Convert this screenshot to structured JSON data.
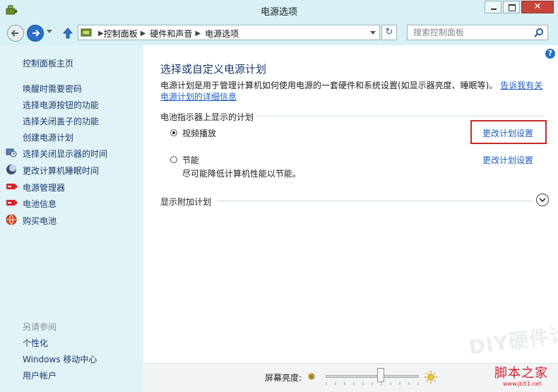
{
  "window": {
    "title": "电源选项"
  },
  "nav": {
    "breadcrumb": [
      "控制面板",
      "硬件和声音",
      "电源选项"
    ],
    "search_placeholder": "搜索控制面板"
  },
  "sidebar": {
    "items": [
      {
        "label": "控制面板主页"
      },
      {
        "label": "唤醒时需要密码"
      },
      {
        "label": "选择电源按钮的功能"
      },
      {
        "label": "选择关闭盖子的功能"
      },
      {
        "label": "创建电源计划"
      },
      {
        "label": "选择关闭显示器的时间",
        "icon": "monitor-clock-icon"
      },
      {
        "label": "更改计算机睡眠时间",
        "icon": "moon-sleep-icon"
      },
      {
        "label": "电源管理器",
        "icon": "battery-red-icon"
      },
      {
        "label": "电池信息",
        "icon": "battery-red-icon"
      },
      {
        "label": "购买电池",
        "icon": "globe-icon"
      }
    ],
    "see_also_label": "另请参阅",
    "see_also": [
      {
        "label": "个性化"
      },
      {
        "label": "Windows 移动中心"
      },
      {
        "label": "用户帐户"
      }
    ]
  },
  "main": {
    "title": "选择或自定义电源计划",
    "description": "电源计划是用于管理计算机如何使用电源的一套硬件和系统设置(如显示器亮度、睡眠等)。",
    "description_link": "告诉我有关电源计划的详细信息",
    "group_label": "电池指示器上显示的计划",
    "plans": [
      {
        "name": "视频播放",
        "description": "",
        "selected": true,
        "link": "更改计划设置"
      },
      {
        "name": "节能",
        "description": "尽可能降低计算机性能以节能。",
        "selected": false,
        "link": "更改计划设置"
      }
    ],
    "additional_plans_label": "显示附加计划"
  },
  "statusbar": {
    "brightness_label": "屏幕亮度:",
    "brightness_level": 0.6
  },
  "watermark": {
    "text": "DIY硬件论坛",
    "logo": "脚本之家",
    "logo_url": "www.jb51.net"
  },
  "colors": {
    "link": "#1f5fc0",
    "sidebar_text": "#1c3a6e",
    "highlight": "#c92a28"
  }
}
